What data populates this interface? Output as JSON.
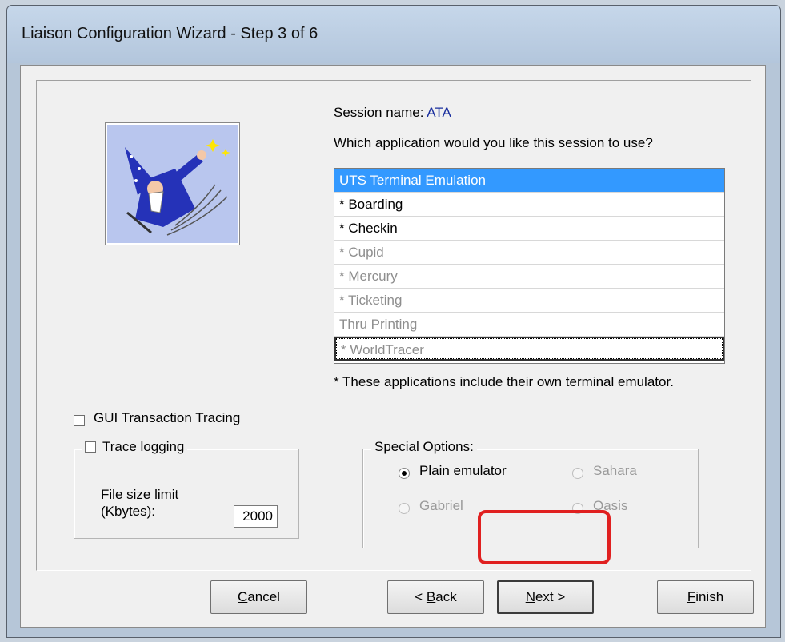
{
  "window": {
    "title": "Liaison Configuration Wizard - Step 3 of 6"
  },
  "session": {
    "label": "Session name:",
    "value": "ATA"
  },
  "question": "Which application would you like this session to use?",
  "applications": [
    {
      "label": "UTS Terminal Emulation",
      "state": "selected"
    },
    {
      "label": "* Boarding",
      "state": "enabled"
    },
    {
      "label": "* Checkin",
      "state": "enabled"
    },
    {
      "label": "* Cupid",
      "state": "disabled"
    },
    {
      "label": "* Mercury",
      "state": "disabled"
    },
    {
      "label": "* Ticketing",
      "state": "disabled"
    },
    {
      "label": "Thru Printing",
      "state": "disabled"
    },
    {
      "label": "* WorldTracer",
      "state": "disabled-focused"
    }
  ],
  "note": "* These applications include their own terminal emulator.",
  "gui_tracing": {
    "label": "GUI Transaction Tracing",
    "checked": false
  },
  "trace_logging": {
    "label": "Trace logging",
    "checked": false,
    "size_label_line1": "File size limit",
    "size_label_line2": "(Kbytes):",
    "size_value": "2000"
  },
  "special_options": {
    "label": "Special Options:",
    "options": {
      "plain_emulator": {
        "label": "Plain emulator",
        "checked": true,
        "enabled": true
      },
      "sahara": {
        "label": "Sahara",
        "checked": false,
        "enabled": false
      },
      "gabriel": {
        "label": "Gabriel",
        "checked": false,
        "enabled": false
      },
      "oasis": {
        "label": "Oasis",
        "checked": false,
        "enabled": false
      }
    }
  },
  "buttons": {
    "cancel": {
      "underline": "C",
      "rest": "ancel"
    },
    "back": {
      "prefix": "< ",
      "underline": "B",
      "rest": "ack"
    },
    "next": {
      "underline": "N",
      "rest": "ext >"
    },
    "finish": {
      "underline": "F",
      "rest": "inish"
    }
  },
  "colors": {
    "highlight": "#e02020",
    "selection": "#3399ff",
    "session_value": "#1a2f9e"
  },
  "icons": [
    "wizard-icon"
  ]
}
